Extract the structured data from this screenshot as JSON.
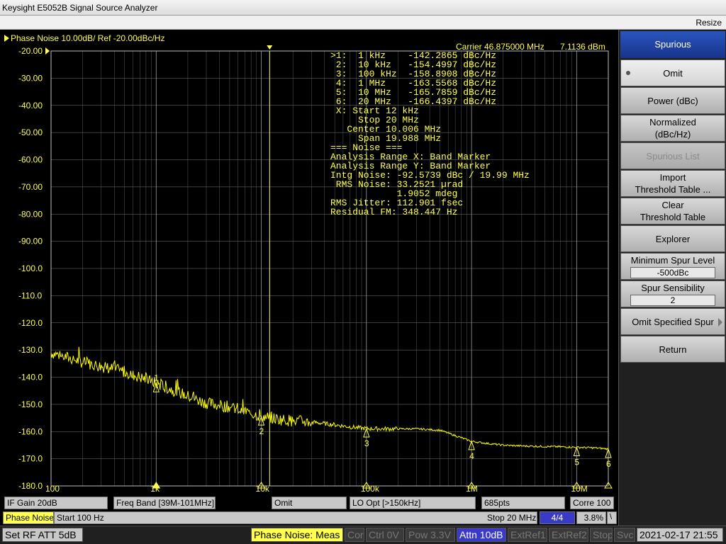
{
  "window": {
    "title": "Keysight E5052B Signal Source Analyzer",
    "resize_label": "Resize"
  },
  "trace": {
    "header": "Phase Noise 10.00dB/ Ref -20.00dBc/Hz",
    "carrier": "Carrier 46.875000 MHz",
    "carrier_level": "7.1136 dBm"
  },
  "readout": [
    ">1:  1 kHz    -142.2865 dBc/Hz",
    " 2:  10 kHz   -154.4997 dBc/Hz",
    " 3:  100 kHz  -158.8908 dBc/Hz",
    " 4:  1 MHz    -163.5568 dBc/Hz",
    " 5:  10 MHz   -165.7859 dBc/Hz",
    " 6:  20 MHz   -166.4397 dBc/Hz",
    " X: Start 12 kHz",
    "     Stop 20 MHz",
    "   Center 10.006 MHz",
    "     Span 19.988 MHz",
    "=== Noise ===",
    "Analysis Range X: Band Marker",
    "Analysis Range Y: Band Marker",
    "Intg Noise: -92.5739 dBc / 19.99 MHz",
    " RMS Noise: 33.2521 µrad",
    "            1.9052 mdeg",
    "RMS Jitter: 112.901 fsec",
    "Residual FM: 348.447 Hz"
  ],
  "chart_data": {
    "type": "line",
    "title": "Phase Noise 10.00dB/ Ref -20.00dBc/Hz",
    "xscale": "log",
    "xlim": [
      100,
      20000000
    ],
    "ylim": [
      -180,
      -20
    ],
    "yticks": [
      "-20.00",
      "-30.00",
      "-40.00",
      "-50.00",
      "-60.00",
      "-70.00",
      "-80.00",
      "-90.00",
      "-100.0",
      "-110.0",
      "-120.0",
      "-130.0",
      "-140.0",
      "-150.0",
      "-160.0",
      "-170.0",
      "-180.0"
    ],
    "xticks": [
      {
        "value": 100,
        "label": "100"
      },
      {
        "value": 1000,
        "label": "1k"
      },
      {
        "value": 10000,
        "label": "10k"
      },
      {
        "value": 100000,
        "label": "100k"
      },
      {
        "value": 1000000,
        "label": "1M"
      },
      {
        "value": 10000000,
        "label": "10M"
      }
    ],
    "grid": true,
    "series": [
      {
        "color": "#ffff00",
        "x": [
          100,
          150,
          200,
          300,
          500,
          700,
          1000,
          1500,
          2000,
          3000,
          5000,
          7000,
          10000,
          15000,
          20000,
          30000,
          50000,
          70000,
          100000,
          150000,
          200000,
          300000,
          500000,
          700000,
          1000000,
          1500000,
          2000000,
          3000000,
          5000000,
          7000000,
          10000000,
          15000000,
          20000000
        ],
        "y": [
          -131,
          -133,
          -134.5,
          -136,
          -138,
          -140,
          -142.3,
          -145,
          -147,
          -149.5,
          -151,
          -152.5,
          -154.5,
          -155.5,
          -156,
          -156.5,
          -157.5,
          -158.3,
          -158.9,
          -159,
          -159,
          -159,
          -159.5,
          -161.5,
          -163.6,
          -164.5,
          -165,
          -165.3,
          -165.5,
          -165.6,
          -165.8,
          -166,
          -166.4
        ]
      }
    ],
    "markers": [
      {
        "label": "1",
        "x": 1000,
        "y": -142.2865
      },
      {
        "label": "2",
        "x": 10000,
        "y": -154.4997
      },
      {
        "label": "3",
        "x": 100000,
        "y": -158.8908
      },
      {
        "label": "4",
        "x": 1000000,
        "y": -163.5568
      },
      {
        "label": "5",
        "x": 10000000,
        "y": -165.7859
      },
      {
        "label": "6",
        "x": 20000000,
        "y": -166.4397
      }
    ]
  },
  "status_row1": {
    "if_gain": "IF Gain 20dB",
    "freq_band": "Freq Band [39M-101MHz]",
    "omit": "Omit",
    "lo_opt": "LO Opt [>150kHz]",
    "points": "685pts",
    "corre": "Corre 100"
  },
  "status_row2": {
    "mode": "Phase Noise",
    "start": "Start 100 Hz",
    "stop": "Stop 20 MHz",
    "trace_num": "4/4",
    "percent": "3.8%"
  },
  "bottom": {
    "set_rf": "Set RF ATT 5dB",
    "meas": "Phase Noise: Meas",
    "cor": "Cor",
    "ctrl": "Ctrl  0V",
    "pow": "Pow  3.3V",
    "attn": "Attn 10dB",
    "extref1": "ExtRef1",
    "extref2": "ExtRef2",
    "stop": "Stop",
    "svc": "Svc",
    "datetime": "2021-02-17 21:55"
  },
  "softkeys": {
    "header": "Spurious",
    "omit": "Omit",
    "power": "Power (dBc)",
    "normalized_1": "Normalized",
    "normalized_2": "(dBc/Hz)",
    "spurious_list": "Spurious List",
    "import_1": "Import",
    "import_2": "Threshold Table ...",
    "clear_1": "Clear",
    "clear_2": "Threshold Table",
    "explorer": "Explorer",
    "min_spur_label": "Minimum Spur Level",
    "min_spur_value": "-500dBc",
    "spur_sens_label": "Spur Sensibility",
    "spur_sens_value": "2",
    "omit_specified": "Omit Specified Spur",
    "return": "Return"
  }
}
